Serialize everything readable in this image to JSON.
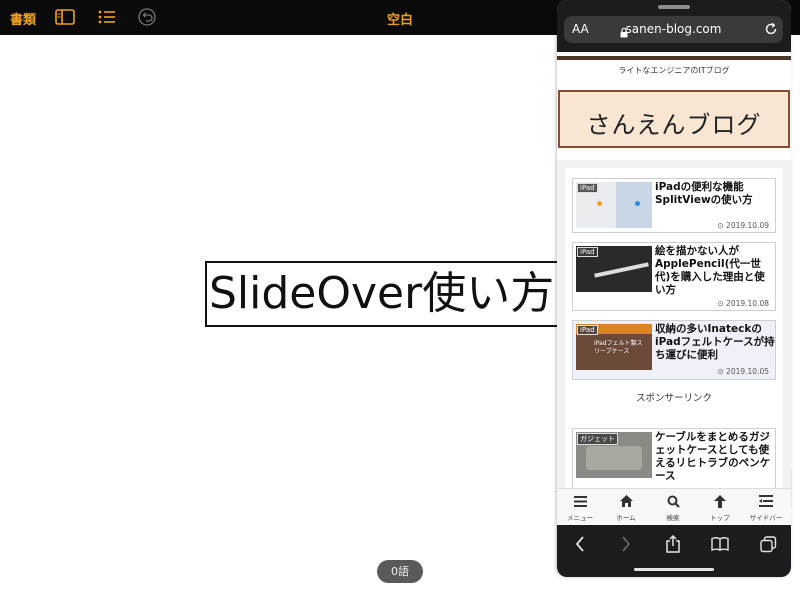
{
  "app": {
    "documents_label": "書類",
    "title": "空白",
    "icons": [
      "sidebar-icon",
      "list-icon",
      "undo-icon"
    ]
  },
  "editor": {
    "heading": "SlideOver使い方",
    "word_count": "0語"
  },
  "browser": {
    "text_size_label": "AA",
    "url": "sanen-blog.com",
    "tagline": "ライトなエンジニアのITブログ",
    "blog_title": "さんえんブログ",
    "articles": [
      {
        "category": "iPad",
        "title": "iPadの便利な機能SplitViewの使い方",
        "date": "2019.10.09"
      },
      {
        "category": "iPad",
        "title": "絵を描かない人がApplePencil(代一世代)を購入した理由と使い方",
        "date": "2019.10.08"
      },
      {
        "category": "iPad",
        "thumb_text": "iPadフェルト製スリーブケース",
        "title": "収納の多いInateckのiPadフェルトケースが持ち運びに便利",
        "date": "2019.10.05"
      },
      {
        "category": "ガジェット",
        "title": "ケーブルをまとめるガジェットケースとしても使えるリヒトラブのペンケース",
        "date": ""
      }
    ],
    "sponsor_label": "スポンサーリンク",
    "bottom_nav": [
      {
        "label": "メニュー",
        "icon": "menu-icon"
      },
      {
        "label": "ホーム",
        "icon": "home-icon"
      },
      {
        "label": "検索",
        "icon": "search-icon"
      },
      {
        "label": "トップ",
        "icon": "arrow-up-icon"
      },
      {
        "label": "サイドバー",
        "icon": "sidebar-icon"
      }
    ],
    "toolbar_icons": [
      "back-icon",
      "forward-icon",
      "share-icon",
      "bookmarks-icon",
      "tabs-icon"
    ]
  },
  "colors": {
    "accent": "#f0a020",
    "blog_header_bg": "#f8e6d2",
    "blog_header_border": "#8b4a2b"
  }
}
